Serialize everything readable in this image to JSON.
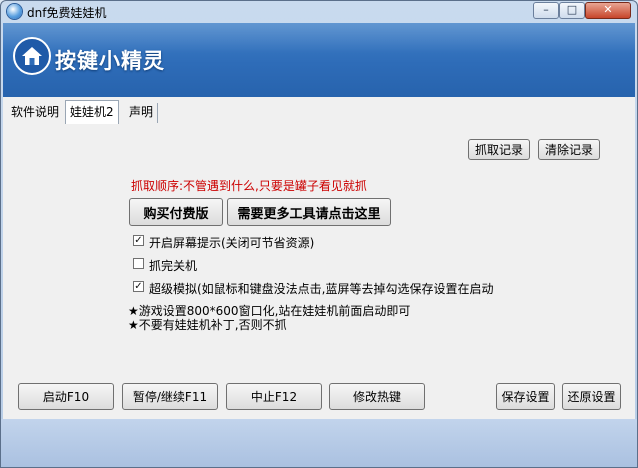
{
  "window": {
    "title": "dnf免费娃娃机",
    "controls": {
      "minimize": "–",
      "maximize": "□",
      "close": "✕"
    }
  },
  "banner": {
    "brand": "按键小精灵"
  },
  "tabs": [
    "软件说明",
    "娃娃机2",
    "声明"
  ],
  "panel": {
    "capture_log_button": "抓取记录",
    "clear_log_button": "清除记录",
    "order_text": "抓取顺序:不管遇到什么,只要是罐子看见就抓",
    "buy_button": "购买付费版",
    "more_tools_button": "需要更多工具请点击这里",
    "options": [
      {
        "label": "开启屏幕提示(关闭可节省资源)",
        "checked": true
      },
      {
        "label": "抓完关机",
        "checked": false
      },
      {
        "label": "超级模拟(如鼠标和键盘没法点击,蓝屏等去掉勾选保存设置在启动",
        "checked": true
      }
    ],
    "notes": [
      "★游戏设置800*600窗口化,站在娃娃机前面启动即可",
      "★不要有娃娃机补丁,否则不抓"
    ]
  },
  "footer_buttons": {
    "start": "启动F10",
    "pause": "暂停/继续F11",
    "stop": "中止F12",
    "hotkey": "修改热键",
    "save": "保存设置",
    "restore": "还原设置"
  }
}
